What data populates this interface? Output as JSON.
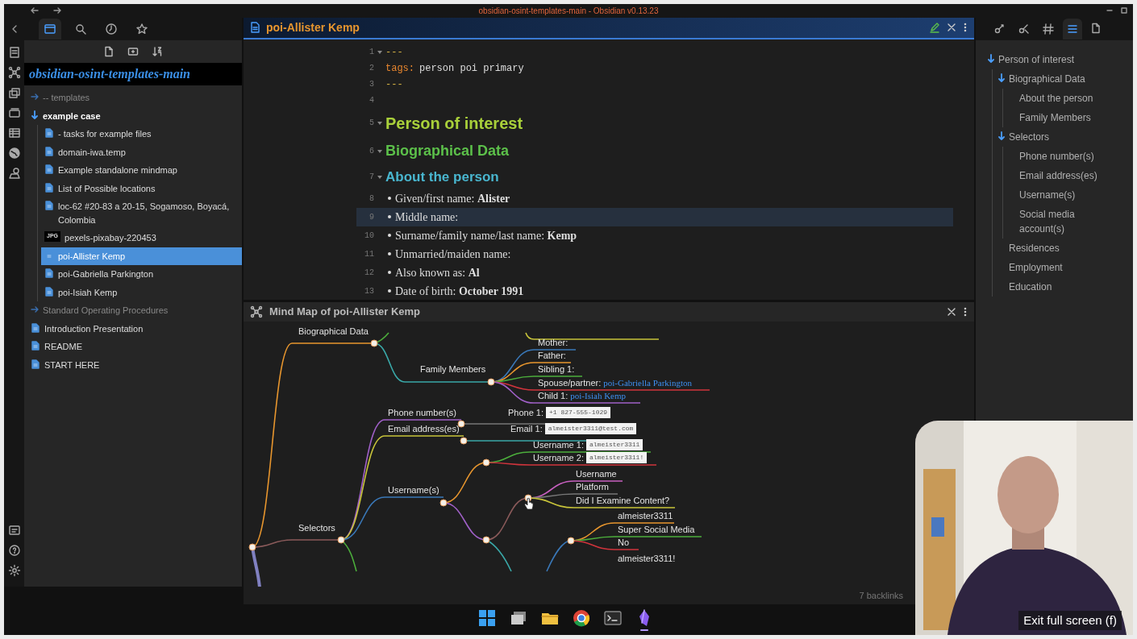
{
  "window": {
    "title": "obsidian-osint-templates-main - Obsidian v0.13.23"
  },
  "explorer": {
    "tabs": [
      {
        "selected": true
      },
      {
        "selected": false
      },
      {
        "selected": false
      },
      {
        "selected": false
      }
    ],
    "vault": "obsidian-osint-templates-main",
    "tree": [
      {
        "label": "-- templates",
        "kind": "folder",
        "expanded": false,
        "selected": false
      },
      {
        "label": "example case",
        "kind": "folder",
        "expanded": true,
        "selected": false,
        "children": [
          {
            "label": "- tasks for example files",
            "kind": "note",
            "selected": false
          },
          {
            "label": "domain-iwa.temp",
            "kind": "note",
            "selected": false
          },
          {
            "label": "Example standalone mindmap",
            "kind": "note",
            "selected": false
          },
          {
            "label": "List of Possible locations",
            "kind": "note",
            "selected": false
          },
          {
            "label": "loc-62 #20-83 a 20-15, Sogamoso, Boyacá, Colombia",
            "kind": "note",
            "selected": false
          },
          {
            "label": "pexels-pixabay-220453",
            "badge": "JPG",
            "selected": false
          },
          {
            "label": "poi-Allister Kemp",
            "kind": "note",
            "selected": true
          },
          {
            "label": "poi-Gabriella Parkington",
            "kind": "note",
            "selected": false
          },
          {
            "label": "poi-Isiah Kemp",
            "kind": "note",
            "selected": false
          }
        ]
      },
      {
        "label": "Standard Operating Procedures",
        "kind": "folder",
        "expanded": false,
        "selected": false
      },
      {
        "label": "Introduction Presentation",
        "kind": "note",
        "selected": false
      },
      {
        "label": "README",
        "kind": "note",
        "selected": false
      },
      {
        "label": "START HERE",
        "kind": "note",
        "selected": false
      }
    ]
  },
  "editor": {
    "tab_title": "poi-Allister Kemp",
    "lines": [
      {
        "number": "1",
        "kind": "frontmatter",
        "text": "---",
        "foldable": true,
        "active": false
      },
      {
        "number": "2",
        "kind": "property",
        "key": "tags:",
        "text": "person poi primary",
        "foldable": false,
        "active": false
      },
      {
        "number": "3",
        "kind": "frontmatter",
        "text": "---",
        "foldable": false,
        "active": false
      },
      {
        "number": "4",
        "kind": "blank",
        "foldable": false,
        "active": false
      },
      {
        "number": "5",
        "kind": "h1",
        "text": "Person of interest",
        "foldable": true,
        "active": false
      },
      {
        "number": "6",
        "kind": "h2",
        "text": "Biographical Data",
        "foldable": true,
        "active": false
      },
      {
        "number": "7",
        "kind": "h3",
        "text": "About the person",
        "foldable": true,
        "active": false
      },
      {
        "number": "8",
        "kind": "bullet",
        "text": "Given/first name: **Alister**",
        "foldable": false,
        "active": false
      },
      {
        "number": "9",
        "kind": "bullet",
        "text": "Middle name:",
        "foldable": false,
        "active": true
      },
      {
        "number": "10",
        "kind": "bullet",
        "text": "Surname/family name/last name: **Kemp**",
        "foldable": false,
        "active": false
      },
      {
        "number": "11",
        "kind": "bullet",
        "text": "Unmarried/maiden name:",
        "foldable": false,
        "active": false
      },
      {
        "number": "12",
        "kind": "bullet",
        "text": "Also known as: **Al**",
        "foldable": false,
        "active": false
      },
      {
        "number": "13",
        "kind": "bullet",
        "text": "Date of birth: **October 1991**",
        "foldable": false,
        "active": false
      }
    ]
  },
  "mind_map": {
    "title": "Mind Map of poi-Allister Kemp",
    "labels": [
      {
        "text": "Biographical Data"
      },
      {
        "text": "Family Members"
      },
      {
        "text": "Mother:"
      },
      {
        "text": "Father:"
      },
      {
        "text": "Sibling 1:"
      },
      {
        "text": "Spouse/partner:",
        "link": "poi-Gabriella Parkington"
      },
      {
        "text": "Child 1:",
        "link": "poi-Isiah Kemp"
      },
      {
        "text": "Phone number(s)"
      },
      {
        "text": "Phone 1:",
        "code": "+1 827-555-1029"
      },
      {
        "text": "Email address(es)"
      },
      {
        "text": "Email 1:",
        "code": "almeister3311@test.com"
      },
      {
        "text": "Username 1:",
        "code": "almeister3311"
      },
      {
        "text": "Username 2:",
        "code": "almeister3311!"
      },
      {
        "text": "Username(s)"
      },
      {
        "text": "Username"
      },
      {
        "text": "Platform"
      },
      {
        "text": "Did I Examine Content?"
      },
      {
        "text": "Selectors"
      },
      {
        "text": "almeister3311"
      },
      {
        "text": "Super Social Media"
      },
      {
        "text": "No"
      },
      {
        "text": "almeister3311!"
      }
    ]
  },
  "right_tabs": [
    {
      "selected": false
    },
    {
      "selected": false
    },
    {
      "selected": false
    },
    {
      "selected": true
    },
    {
      "selected": false
    }
  ],
  "outline": [
    {
      "label": "Person of interest",
      "expanded": true,
      "children": [
        {
          "label": "Biographical Data",
          "expanded": true,
          "children": [
            {
              "label": "About the person"
            },
            {
              "label": "Family Members"
            }
          ]
        },
        {
          "label": "Selectors",
          "expanded": true,
          "children": [
            {
              "label": "Phone number(s)"
            },
            {
              "label": "Email address(es)"
            },
            {
              "label": "Username(s)"
            },
            {
              "label": "Social media account(s)"
            }
          ]
        },
        {
          "label": "Residences"
        },
        {
          "label": "Employment"
        },
        {
          "label": "Education"
        }
      ]
    }
  ],
  "status_bar": {
    "backlinks": "7 backlinks"
  },
  "taskbar": [
    {
      "active": false
    },
    {
      "active": false
    },
    {
      "active": false
    },
    {
      "active": false
    },
    {
      "active": false
    },
    {
      "active": true
    }
  ],
  "video_overlay": {
    "kind": "picture",
    "hint": "Exit full screen (f)"
  }
}
